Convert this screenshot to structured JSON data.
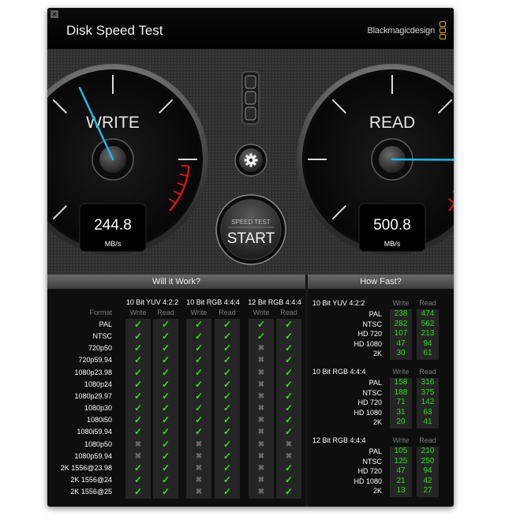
{
  "window": {
    "title": "Disk Speed Test",
    "brand": "Blackmagicdesign",
    "close_glyph": "×"
  },
  "gauges": {
    "write": {
      "label": "WRITE",
      "value": "244.8",
      "unit": "MB/s"
    },
    "read": {
      "label": "READ",
      "value": "500.8",
      "unit": "MB/s"
    }
  },
  "controls": {
    "start_top": "SPEED TEST",
    "start_main": "START",
    "settings_icon": "gear-icon",
    "selector_count": 3
  },
  "will_it_work": {
    "title": "Will it Work?",
    "format_label": "Format",
    "groups": [
      {
        "name": "10 Bit YUV 4:2:2",
        "cols": [
          "Write",
          "Read"
        ]
      },
      {
        "name": "10 Bit RGB 4:4:4",
        "cols": [
          "Write",
          "Read"
        ]
      },
      {
        "name": "12 Bit RGB 4:4:4",
        "cols": [
          "Write",
          "Read"
        ]
      }
    ],
    "rows": [
      {
        "format": "PAL",
        "marks": [
          1,
          1,
          1,
          1,
          1,
          1
        ]
      },
      {
        "format": "NTSC",
        "marks": [
          1,
          1,
          1,
          1,
          1,
          1
        ]
      },
      {
        "format": "720p50",
        "marks": [
          1,
          1,
          1,
          1,
          0,
          1
        ]
      },
      {
        "format": "720p59.94",
        "marks": [
          1,
          1,
          1,
          1,
          0,
          1
        ]
      },
      {
        "format": "1080p23.98",
        "marks": [
          1,
          1,
          1,
          1,
          0,
          1
        ]
      },
      {
        "format": "1080p24",
        "marks": [
          1,
          1,
          1,
          1,
          0,
          1
        ]
      },
      {
        "format": "1080p29.97",
        "marks": [
          1,
          1,
          1,
          1,
          0,
          1
        ]
      },
      {
        "format": "1080p30",
        "marks": [
          1,
          1,
          1,
          1,
          0,
          1
        ]
      },
      {
        "format": "1080i50",
        "marks": [
          1,
          1,
          1,
          1,
          0,
          1
        ]
      },
      {
        "format": "1080i59.94",
        "marks": [
          1,
          1,
          1,
          1,
          0,
          1
        ]
      },
      {
        "format": "1080p50",
        "marks": [
          0,
          1,
          0,
          1,
          0,
          0
        ]
      },
      {
        "format": "1080p59.94",
        "marks": [
          0,
          1,
          0,
          1,
          0,
          0
        ]
      },
      {
        "format": "2K 1556@23.98",
        "marks": [
          1,
          1,
          0,
          1,
          0,
          1
        ]
      },
      {
        "format": "2K 1556@24",
        "marks": [
          1,
          1,
          0,
          1,
          0,
          1
        ]
      },
      {
        "format": "2K 1556@25",
        "marks": [
          1,
          1,
          0,
          1,
          0,
          1
        ]
      }
    ]
  },
  "how_fast": {
    "title": "How Fast?",
    "write_label": "Write",
    "read_label": "Read",
    "sections": [
      {
        "name": "10 Bit YUV 4:2:2",
        "rows": [
          {
            "format": "PAL",
            "write": "238",
            "read": "474"
          },
          {
            "format": "NTSC",
            "write": "282",
            "read": "562"
          },
          {
            "format": "HD 720",
            "write": "107",
            "read": "213"
          },
          {
            "format": "HD 1080",
            "write": "47",
            "read": "94"
          },
          {
            "format": "2K",
            "write": "30",
            "read": "61"
          }
        ]
      },
      {
        "name": "10 Bit RGB 4:4:4",
        "rows": [
          {
            "format": "PAL",
            "write": "158",
            "read": "316"
          },
          {
            "format": "NTSC",
            "write": "188",
            "read": "375"
          },
          {
            "format": "HD 720",
            "write": "71",
            "read": "142"
          },
          {
            "format": "HD 1080",
            "write": "31",
            "read": "63"
          },
          {
            "format": "2K",
            "write": "20",
            "read": "41"
          }
        ]
      },
      {
        "name": "12 Bit RGB 4:4:4",
        "rows": [
          {
            "format": "PAL",
            "write": "105",
            "read": "210"
          },
          {
            "format": "NTSC",
            "write": "125",
            "read": "250"
          },
          {
            "format": "HD 720",
            "write": "47",
            "read": "94"
          },
          {
            "format": "HD 1080",
            "write": "21",
            "read": "42"
          },
          {
            "format": "2K",
            "write": "13",
            "read": "27"
          }
        ]
      }
    ]
  },
  "colors": {
    "check": "#35e11c",
    "cross": "#6a6a6a",
    "numbers": "#27e013",
    "needle": "#1fb8e8",
    "redline": "#d01616",
    "brand_accent": "#f5a81e"
  }
}
